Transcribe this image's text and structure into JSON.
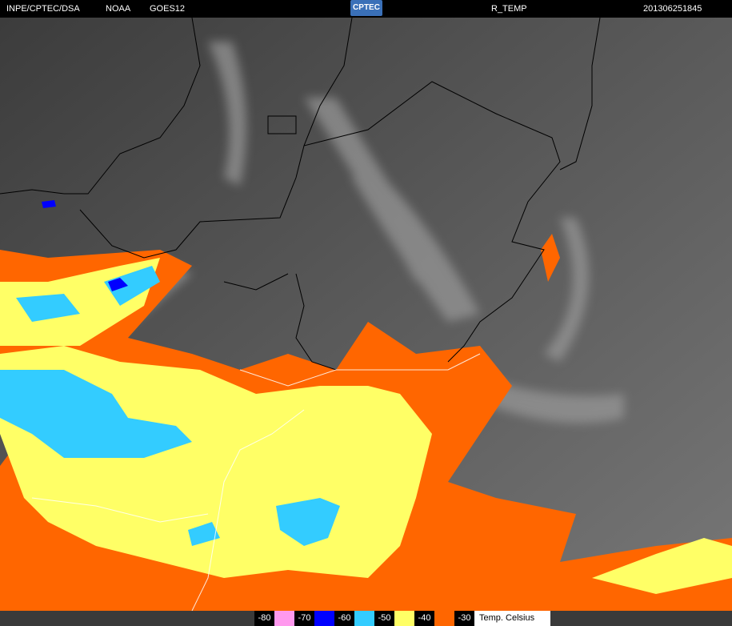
{
  "header": {
    "agency": "INPE/CPTEC/DSA",
    "source": "NOAA",
    "satellite": "GOES12",
    "logo_text": "CPTEC",
    "product": "R_TEMP",
    "timestamp": "201306251845"
  },
  "legend": {
    "items": [
      {
        "label": "-80",
        "color": "#ff99ee"
      },
      {
        "label": "-70",
        "color": "#0000ff"
      },
      {
        "label": "-60",
        "color": "#33ccff"
      },
      {
        "label": "-50",
        "color": "#ffff66"
      },
      {
        "label": "-40",
        "color": "#ff6600"
      },
      {
        "label": "-30",
        "color": null
      }
    ],
    "unit": "Temp. Celsius"
  }
}
